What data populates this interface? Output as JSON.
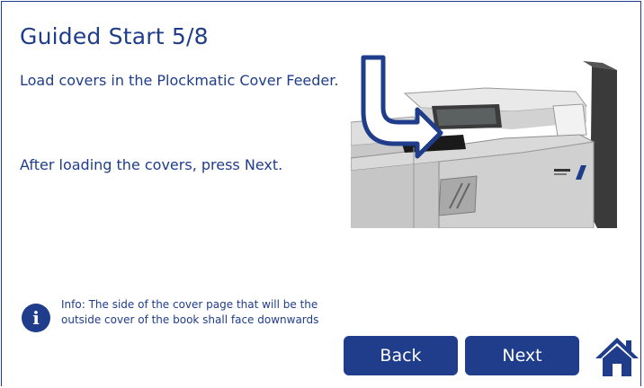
{
  "header": {
    "title": "Guided Start 5/8"
  },
  "main": {
    "instruction": "Load covers in the Plockmatic Cover Feeder.",
    "instruction_next": "After loading the covers, press Next."
  },
  "info": {
    "icon": "info-icon",
    "text": "Info: The side of the cover page that will be the outside cover of the book shall face downwards"
  },
  "buttons": {
    "back_label": "Back",
    "next_label": "Next",
    "home_icon": "home-icon"
  },
  "colors": {
    "accent": "#1f3d8a",
    "background": "#ffffff"
  }
}
